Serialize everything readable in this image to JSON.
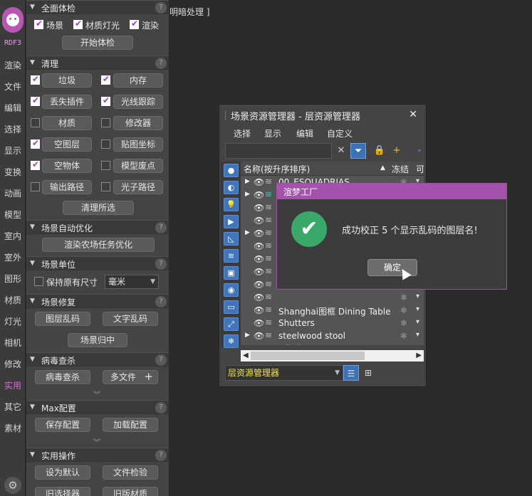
{
  "brand": "RDF3",
  "left_tabs": [
    "渲染",
    "文件",
    "编辑",
    "选择",
    "显示",
    "变换",
    "动画",
    "模型",
    "室内",
    "室外",
    "图形",
    "材质",
    "灯光",
    "相机",
    "修改",
    "实用",
    "其它",
    "素材"
  ],
  "active_tab": "实用",
  "viewport_text": "明暗处理 ]",
  "panel": {
    "full_check": {
      "title": "全面体检",
      "options": [
        {
          "label": "场景",
          "checked": true
        },
        {
          "label": "材质灯光",
          "checked": true
        },
        {
          "label": "渲染",
          "checked": true
        }
      ],
      "start_button": "开始体检"
    },
    "cleanup": {
      "title": "清理",
      "items": [
        {
          "label": "垃圾",
          "checked": true
        },
        {
          "label": "内存",
          "checked": true
        },
        {
          "label": "丢失插件",
          "checked": true
        },
        {
          "label": "光线跟踪",
          "checked": true
        },
        {
          "label": "材质",
          "checked": false
        },
        {
          "label": "修改器",
          "checked": false
        },
        {
          "label": "空图层",
          "checked": true
        },
        {
          "label": "贴图坐标",
          "checked": false
        },
        {
          "label": "空物体",
          "checked": true
        },
        {
          "label": "模型废点",
          "checked": false
        },
        {
          "label": "输出路径",
          "checked": false
        },
        {
          "label": "光子路径",
          "checked": false
        }
      ],
      "clean_selected": "清理所选"
    },
    "auto_opt": {
      "title": "场景自动优化",
      "button": "渲染农场任务优化"
    },
    "units": {
      "title": "场景单位",
      "keep_label": "保持原有尺寸",
      "keep_checked": false,
      "unit": "毫米"
    },
    "repair": {
      "title": "场景修复",
      "btn1": "图层乱码",
      "btn2": "文字乱码",
      "btn3": "场景归中"
    },
    "virus": {
      "title": "病毒查杀",
      "btn1": "病毒查杀",
      "btn2": "多文件",
      "plus": "+"
    },
    "max": {
      "title": "Max配置",
      "btn1": "保存配置",
      "btn2": "加载配置"
    },
    "utility": {
      "title": "实用操作",
      "btn1": "设为默认",
      "btn2": "文件检验",
      "btn3": "旧选择器",
      "btn4": "旧版材质"
    }
  },
  "explorer": {
    "title": "场景资源管理器 - 层资源管理器",
    "menu": [
      "选择",
      "显示",
      "编辑",
      "自定义"
    ],
    "columns": {
      "name": "名称(按升序排序)",
      "freeze": "冻结",
      "render": "可"
    },
    "rows": [
      {
        "name": "00_ESQUADRIAS",
        "expand": true
      },
      {
        "name": "",
        "expand": true
      },
      {
        "name": "",
        "expand": false
      },
      {
        "name": "",
        "expand": false
      },
      {
        "name": "",
        "expand": true
      },
      {
        "name": "",
        "expand": false
      },
      {
        "name": "",
        "expand": false
      },
      {
        "name": "",
        "expand": false
      },
      {
        "name": "",
        "expand": false
      },
      {
        "name": "",
        "expand": false
      },
      {
        "name": "Shanghai图框 Dining Table",
        "expand": false
      },
      {
        "name": "Shutters",
        "expand": false
      },
      {
        "name": "steelwood stool",
        "expand": true
      },
      {
        "name": "Window",
        "expand": true
      }
    ],
    "bottom_select": "层资源管理器"
  },
  "dialog": {
    "title": "渲梦工厂",
    "message": "成功校正 5 个显示乱码的图层名!",
    "ok": "确定"
  },
  "colors": {
    "accent": "#a552ad",
    "success": "#3aa86a",
    "tool_blue": "#3c72b8"
  }
}
